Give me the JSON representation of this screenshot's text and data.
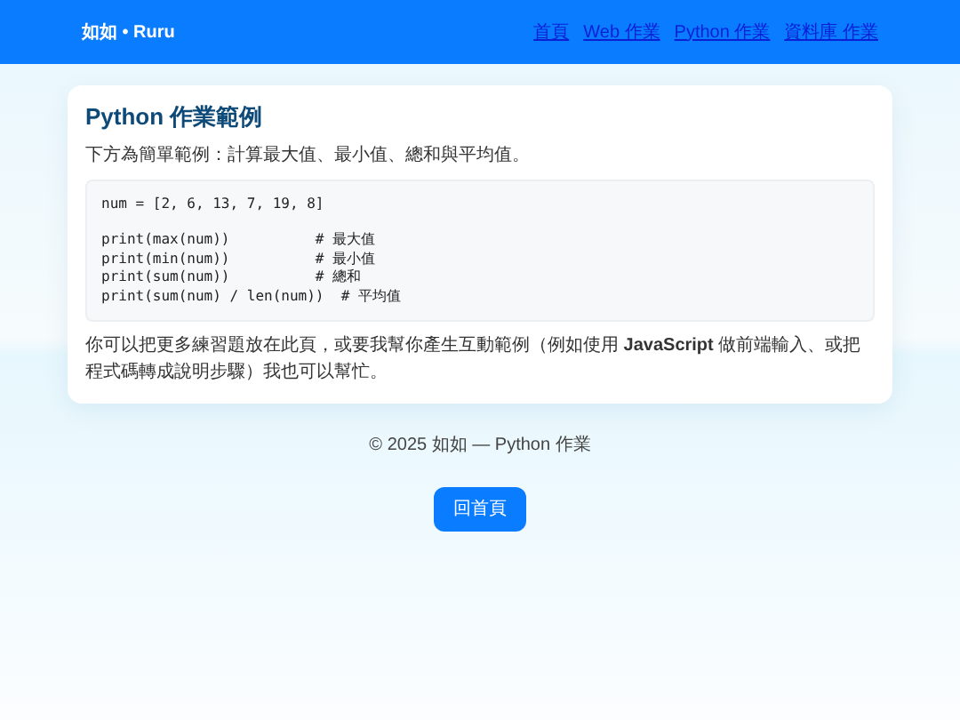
{
  "navbar": {
    "brand": "如如 • Ruru",
    "links": [
      {
        "label": "首頁"
      },
      {
        "label": "Web 作業"
      },
      {
        "label": "Python 作業"
      },
      {
        "label": "資料庫 作業"
      }
    ]
  },
  "card": {
    "title": "Python 作業範例",
    "intro": "下方為簡單範例：計算最大值、最小值、總和與平均值。",
    "code": "num = [2, 6, 13, 7, 19, 8]\n\nprint(max(num))          # 最大值\nprint(min(num))          # 最小值\nprint(sum(num))          # 總和\nprint(sum(num) / len(num))  # 平均值",
    "note": "你可以把更多練習題放在此頁，或要我幫你產生互動範例（例如使用 **JavaScript** 做前端輸入、或把程式碼轉成說明步驟）我也可以幫忙。"
  },
  "footer": {
    "text": "© 2025 如如 — Python 作業",
    "button": "回首頁"
  }
}
